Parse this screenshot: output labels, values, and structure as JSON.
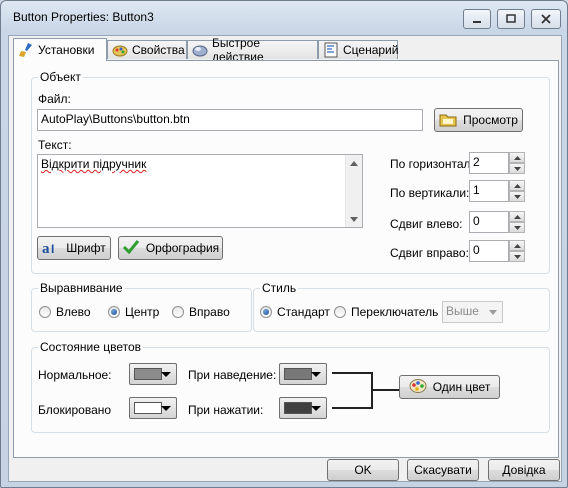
{
  "window": {
    "title": "Button Properties: Button3"
  },
  "tabs": [
    {
      "label": "Установки",
      "icon": "broom-icon"
    },
    {
      "label": "Свойства",
      "icon": "palette-icon"
    },
    {
      "label": "Быстрое действие",
      "icon": "action-icon"
    },
    {
      "label": "Сценарий",
      "icon": "script-icon"
    }
  ],
  "object_group": {
    "label": "Объект",
    "file_label": "Файл:",
    "file_value": "AutoPlay\\Buttons\\button.btn",
    "browse_label": "Просмотр",
    "text_label": "Текст:",
    "text_value": "Відкрити підручник",
    "font_label": "Шрифт",
    "spell_label": "Орфография",
    "h_label": "По горизонтали:",
    "h_value": "2",
    "v_label": "По вертикали:",
    "v_value": "1",
    "left_label": "Сдвиг влево:",
    "left_value": "0",
    "right_label": "Сдвиг вправо:",
    "right_value": "0"
  },
  "align_group": {
    "label": "Выравнивание",
    "options": [
      "Влево",
      "Центр",
      "Вправо"
    ],
    "selected": "Центр"
  },
  "style_group": {
    "label": "Стиль",
    "standard": "Стандарт",
    "toggle": "Переключатель",
    "selected": "Стандарт",
    "state_select": "Выше"
  },
  "color_group": {
    "label": "Состояние цветов",
    "normal_label": "Нормальное:",
    "normal_color": "#8c8c8c",
    "hover_label": "При наведение:",
    "hover_color": "#787878",
    "disabled_label": "Блокировано",
    "disabled_color": "#ffffff",
    "pressed_label": "При нажатии:",
    "pressed_color": "#404040",
    "single_color_label": "Один цвет"
  },
  "footer": {
    "ok": "OK",
    "cancel": "Скасувати",
    "help": "Довідка"
  }
}
